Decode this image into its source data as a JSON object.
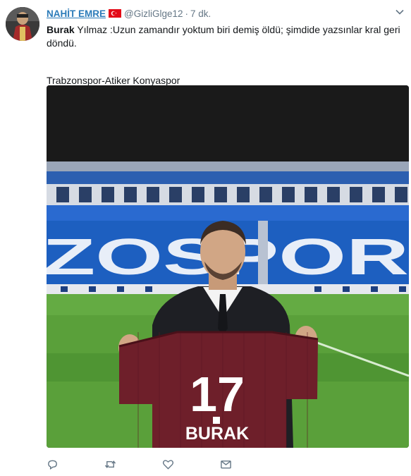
{
  "tweet": {
    "display_name": "NAHİT EMRE",
    "flag_icon": "turkey-flag-icon",
    "handle": "@GizliGlge12",
    "separator": "·",
    "time": "7 dk.",
    "text_bold": "Burak",
    "text_rest": " Yılmaz :Uzun zamandır yoktum biri demiş öldü; şimdide yazsınlar kral geri döndü.",
    "text_line2": "Trabzonspor-Atiker Konyaspor",
    "media": {
      "jersey_number": "17",
      "jersey_name": "BURAK",
      "stadium_seat_letters": "ZOSPOR",
      "colors": {
        "jersey": "#6e1f2a",
        "seats": "#1d5fc0",
        "pitch": "#5aa03a"
      }
    },
    "actions": [
      {
        "name": "reply",
        "icon": "reply-icon"
      },
      {
        "name": "retweet",
        "icon": "retweet-icon"
      },
      {
        "name": "like",
        "icon": "heart-icon"
      },
      {
        "name": "message",
        "icon": "envelope-icon"
      }
    ],
    "colors": {
      "link": "#2b7bb9",
      "muted": "#657786",
      "text": "#14171a"
    }
  }
}
